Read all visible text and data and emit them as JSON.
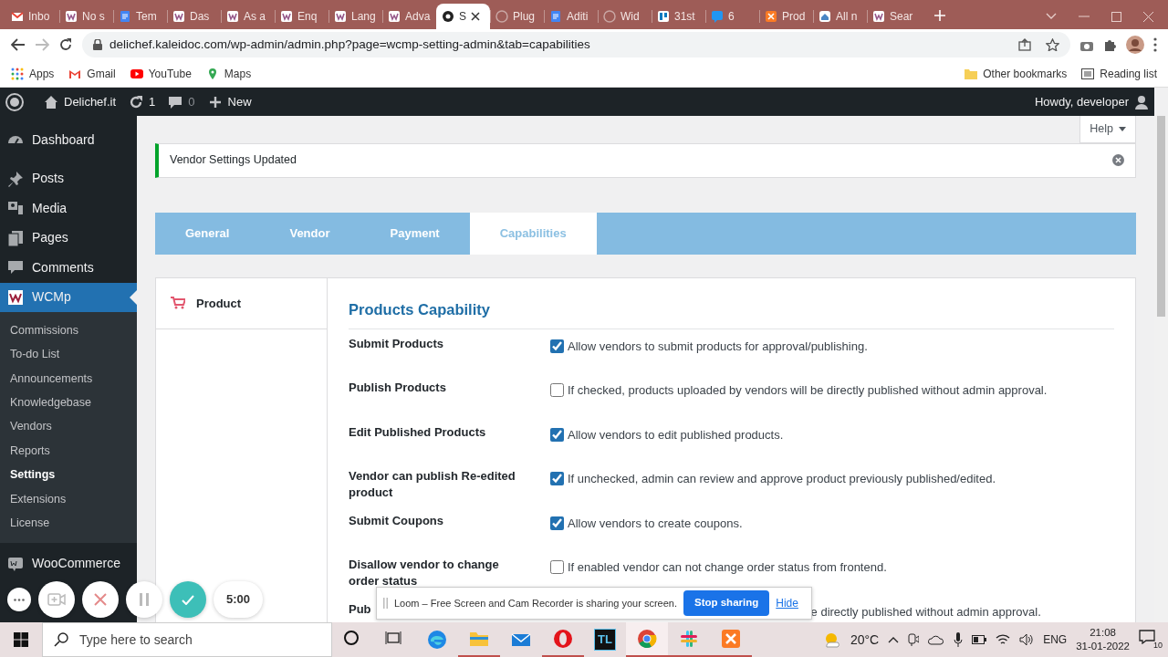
{
  "browser": {
    "tabs": [
      {
        "title": "Inbo",
        "kind": "mail",
        "selected": false
      },
      {
        "title": "No s",
        "kind": "wp",
        "selected": false
      },
      {
        "title": "Tem",
        "kind": "doc",
        "selected": false
      },
      {
        "title": "Das",
        "kind": "wp",
        "selected": false
      },
      {
        "title": "As a",
        "kind": "wp",
        "selected": false
      },
      {
        "title": "Enq",
        "kind": "wp",
        "selected": false
      },
      {
        "title": "Lang",
        "kind": "wp",
        "selected": false
      },
      {
        "title": "Adva",
        "kind": "wp",
        "selected": false
      },
      {
        "title": "S",
        "kind": "loom",
        "selected": true
      },
      {
        "title": "Plug",
        "kind": "dim",
        "selected": false
      },
      {
        "title": "Aditi",
        "kind": "doc",
        "selected": false
      },
      {
        "title": "Wid",
        "kind": "dim",
        "selected": false
      },
      {
        "title": "31st",
        "kind": "board",
        "selected": false
      },
      {
        "title": "6",
        "kind": "chat",
        "selected": false
      },
      {
        "title": "Prod",
        "kind": "xampp",
        "selected": false
      },
      {
        "title": "All n",
        "kind": "globe",
        "selected": false
      },
      {
        "title": "Sear",
        "kind": "wp",
        "selected": false
      }
    ],
    "url": "delichef.kaleidoc.com/wp-admin/admin.php?page=wcmp-setting-admin&tab=capabilities",
    "bookmarks": [
      {
        "label": "Apps",
        "kind": "apps"
      },
      {
        "label": "Gmail",
        "kind": "gmail"
      },
      {
        "label": "YouTube",
        "kind": "youtube"
      },
      {
        "label": "Maps",
        "kind": "maps"
      }
    ],
    "other_bookmarks": "Other bookmarks",
    "reading_list": "Reading list"
  },
  "admin_bar": {
    "site": "Delichef.it",
    "updates": "1",
    "comments": "0",
    "new": "New",
    "howdy": "Howdy, developer"
  },
  "sidebar": {
    "items": [
      {
        "label": "Dashboard",
        "kind": "dashboard",
        "selected": false
      },
      {
        "label": "Posts",
        "kind": "posts",
        "selected": false
      },
      {
        "label": "Media",
        "kind": "media",
        "selected": false
      },
      {
        "label": "Pages",
        "kind": "pages",
        "selected": false
      },
      {
        "label": "Comments",
        "kind": "comments",
        "selected": false
      },
      {
        "label": "WCMp",
        "kind": "wcmp",
        "selected": true,
        "children": [
          {
            "label": "Commissions",
            "selected": false
          },
          {
            "label": "To-do List",
            "selected": false
          },
          {
            "label": "Announcements",
            "selected": false
          },
          {
            "label": "Knowledgebase",
            "selected": false
          },
          {
            "label": "Vendors",
            "selected": false
          },
          {
            "label": "Reports",
            "selected": false
          },
          {
            "label": "Settings",
            "selected": true
          },
          {
            "label": "Extensions",
            "selected": false
          },
          {
            "label": "License",
            "selected": false
          }
        ]
      },
      {
        "label": "WooCommerce",
        "kind": "woo",
        "selected": false
      }
    ]
  },
  "help": "Help",
  "notice": "Vendor Settings Updated",
  "settings_tabs": [
    {
      "label": "General",
      "selected": false
    },
    {
      "label": "Vendor",
      "selected": false
    },
    {
      "label": "Payment",
      "selected": false
    },
    {
      "label": "Capabilities",
      "selected": true
    }
  ],
  "side_tabs": [
    {
      "label": "Product",
      "selected": true
    }
  ],
  "section_title": "Products Capability",
  "rows": [
    {
      "kind": "checkbox",
      "label": "Submit Products",
      "checked": true,
      "description": "Allow vendors to submit products for approval/publishing."
    },
    {
      "kind": "checkbox",
      "label": "Publish Products",
      "checked": false,
      "description": "If checked, products uploaded by vendors will be directly published without admin approval."
    },
    {
      "kind": "checkbox",
      "label": "Edit Published Products",
      "checked": true,
      "description": "Allow vendors to edit published products."
    },
    {
      "kind": "checkbox",
      "label": "Vendor can publish Re-edited product",
      "checked": true,
      "description": "If unchecked, admin can review and approve product previously published/edited."
    },
    {
      "kind": "checkbox",
      "label": "Submit Coupons",
      "checked": true,
      "description": "Allow vendors to create coupons."
    },
    {
      "kind": "checkbox",
      "label": "Disallow vendor to change order status",
      "checked": false,
      "description": "If enabled vendor can not change order status from frontend."
    },
    {
      "kind": "covered",
      "label": "Pub",
      "description": "e directly published without admin approval."
    }
  ],
  "loom_controls": {
    "timer": "5:00"
  },
  "loom_toast": {
    "message": "Loom – Free Screen and Cam Recorder is sharing your screen.",
    "stop": "Stop sharing",
    "hide": "Hide"
  },
  "taskbar": {
    "search_placeholder": "Type here to search",
    "apps": [
      {
        "kind": "cortana",
        "running": false,
        "selected": false
      },
      {
        "kind": "taskview",
        "running": false,
        "selected": false
      },
      {
        "kind": "edge",
        "running": false,
        "selected": false
      },
      {
        "kind": "files",
        "running": true,
        "selected": false
      },
      {
        "kind": "mail",
        "running": false,
        "selected": false
      },
      {
        "kind": "opera",
        "running": true,
        "selected": false
      },
      {
        "kind": "tl",
        "label": "TL",
        "running": false,
        "selected": false
      },
      {
        "kind": "chrome",
        "running": true,
        "selected": true
      },
      {
        "kind": "slack",
        "running": true,
        "selected": false
      },
      {
        "kind": "xampp",
        "running": true,
        "selected": false
      }
    ],
    "temperature": "20°C",
    "language": "ENG",
    "time": "21:08",
    "date": "31-01-2022",
    "notifications": "10"
  }
}
